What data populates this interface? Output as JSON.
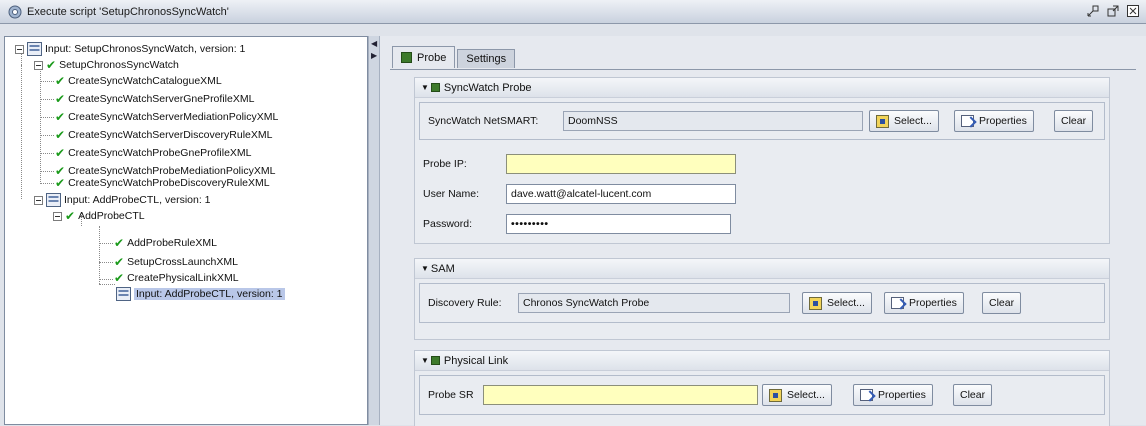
{
  "window": {
    "title": "Execute script 'SetupChronosSyncWatch'"
  },
  "tree": {
    "items": [
      {
        "label": "Input: SetupChronosSyncWatch, version: 1"
      },
      {
        "label": "SetupChronosSyncWatch"
      },
      {
        "label": "CreateSyncWatchCatalogueXML"
      },
      {
        "label": "CreateSyncWatchServerGneProfileXML"
      },
      {
        "label": "CreateSyncWatchServerMediationPolicyXML"
      },
      {
        "label": "CreateSyncWatchServerDiscoveryRuleXML"
      },
      {
        "label": "CreateSyncWatchProbeGneProfileXML"
      },
      {
        "label": "CreateSyncWatchProbeMediationPolicyXML"
      },
      {
        "label": "CreateSyncWatchProbeDiscoveryRuleXML"
      },
      {
        "label": "Input: AddProbeCTL, version: 1"
      },
      {
        "label": "AddProbeCTL"
      },
      {
        "label": "AddProbeRuleXML"
      },
      {
        "label": "SetupCrossLaunchXML"
      },
      {
        "label": "CreatePhysicalLinkXML"
      },
      {
        "label": "Input: AddProbeCTL, version: 1"
      }
    ]
  },
  "tabs": [
    {
      "label": "Probe"
    },
    {
      "label": "Settings"
    }
  ],
  "syncwatch": {
    "title": "SyncWatch Probe",
    "netsmart_label": "SyncWatch NetSMART:",
    "netsmart_value": "DoomNSS",
    "probe_ip_label": "Probe IP:",
    "probe_ip_value": "",
    "username_label": "User Name:",
    "username_value": "dave.watt@alcatel-lucent.com",
    "password_label": "Password:",
    "password_value": "•••••••••"
  },
  "sam": {
    "title": "SAM",
    "discovery_label": "Discovery Rule:",
    "discovery_value": "Chronos SyncWatch Probe"
  },
  "physical_link": {
    "title": "Physical Link",
    "probe_sr_label": "Probe SR",
    "probe_sr_value": ""
  },
  "buttons": {
    "select": "Select...",
    "properties": "Properties",
    "clear": "Clear"
  },
  "colors": {
    "check": "#1a9a1a",
    "required_field": "#ffffbe",
    "selection": "#b9c7e8"
  }
}
